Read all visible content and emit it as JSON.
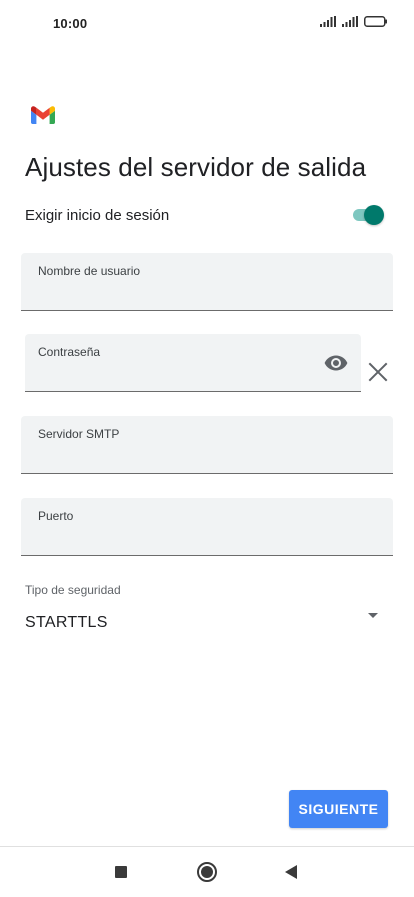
{
  "status_bar": {
    "time": "10:00",
    "icons": [
      "signal-icon",
      "signal-icon",
      "battery-icon"
    ]
  },
  "app": {
    "logo": "gmail-logo"
  },
  "page": {
    "title": "Ajustes del servidor de salida"
  },
  "login_required": {
    "label": "Exigir inicio de sesión",
    "enabled": true,
    "accent_color": "#00796b"
  },
  "fields": {
    "username": {
      "label": "Nombre de usuario",
      "value": ""
    },
    "password": {
      "label": "Contraseña",
      "value": "",
      "icons": [
        "eye-icon",
        "close-icon"
      ]
    },
    "smtp_server": {
      "label": "Servidor SMTP",
      "value": ""
    },
    "port": {
      "label": "Puerto",
      "value": ""
    }
  },
  "security": {
    "label": "Tipo de seguridad",
    "selected": "STARTTLS"
  },
  "actions": {
    "next_label": "SIGUIENTE",
    "next_color": "#4285f4"
  },
  "nav_bar": {
    "icons": [
      "recents-icon",
      "home-icon",
      "back-icon"
    ]
  }
}
